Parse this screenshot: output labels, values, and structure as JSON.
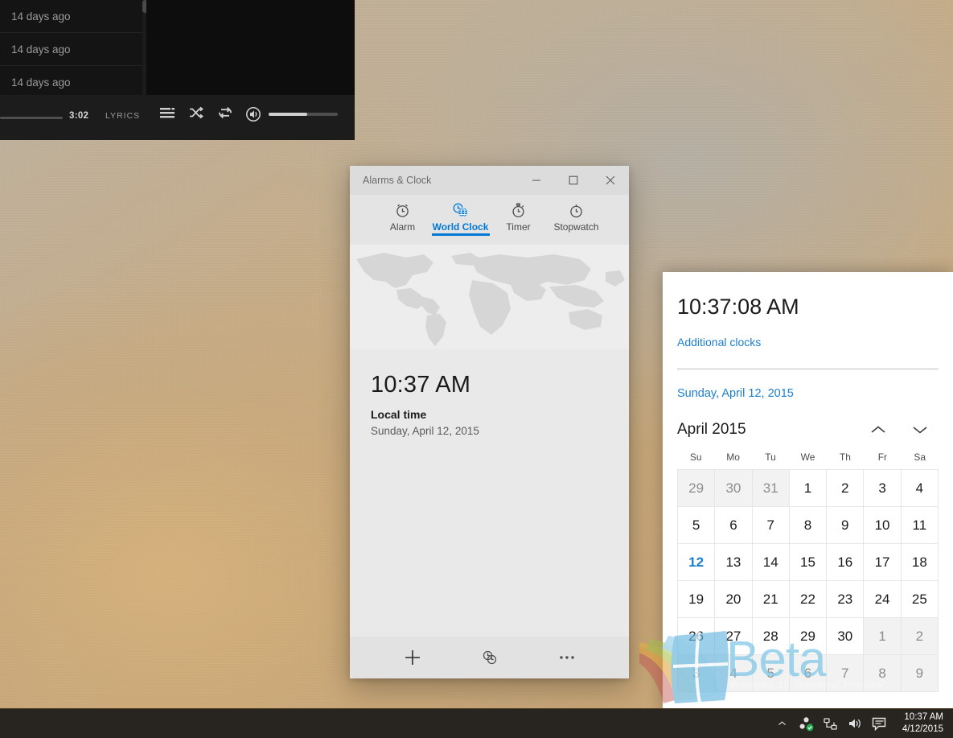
{
  "media_player": {
    "rows": [
      {
        "time_ago": "14 days ago"
      },
      {
        "time_ago": "14 days ago"
      },
      {
        "time_ago": "14 days ago"
      }
    ],
    "track_time": "3:02",
    "lyrics_label": "LYRICS",
    "icons": [
      "queue-icon",
      "shuffle-icon",
      "repeat-icon",
      "volume-icon"
    ]
  },
  "clock_app": {
    "title": "Alarms & Clock",
    "window_buttons": {
      "minimize": "minimize-button",
      "maximize": "maximize-button",
      "close": "close-button"
    },
    "tabs": [
      {
        "label": "Alarm",
        "icon": "alarm-clock-icon",
        "active": false
      },
      {
        "label": "World Clock",
        "icon": "world-clock-icon",
        "active": true
      },
      {
        "label": "Timer",
        "icon": "timer-icon",
        "active": false
      },
      {
        "label": "Stopwatch",
        "icon": "stopwatch-icon",
        "active": false
      }
    ],
    "local": {
      "time": "10:37 AM",
      "label": "Local time",
      "date": "Sunday, April 12, 2015"
    },
    "bottom_bar": [
      {
        "name": "add-clock-button",
        "glyph": "+"
      },
      {
        "name": "compare-clocks-button",
        "glyph": "compare-icon"
      },
      {
        "name": "more-options-button",
        "glyph": "..."
      }
    ]
  },
  "calendar_flyout": {
    "clock": "10:37:08 AM",
    "additional_clocks_link": "Additional clocks",
    "current_date": "Sunday, April 12, 2015",
    "month_label": "April 2015",
    "prev_label": "up-chevron-icon",
    "next_label": "down-chevron-icon",
    "day_headers": [
      "Su",
      "Mo",
      "Tu",
      "We",
      "Th",
      "Fr",
      "Sa"
    ],
    "weeks": [
      [
        {
          "d": "29",
          "other": true
        },
        {
          "d": "30",
          "other": true
        },
        {
          "d": "31",
          "other": true
        },
        {
          "d": "1"
        },
        {
          "d": "2"
        },
        {
          "d": "3"
        },
        {
          "d": "4"
        }
      ],
      [
        {
          "d": "5"
        },
        {
          "d": "6"
        },
        {
          "d": "7"
        },
        {
          "d": "8"
        },
        {
          "d": "9"
        },
        {
          "d": "10"
        },
        {
          "d": "11"
        }
      ],
      [
        {
          "d": "12",
          "today": true
        },
        {
          "d": "13"
        },
        {
          "d": "14"
        },
        {
          "d": "15"
        },
        {
          "d": "16"
        },
        {
          "d": "17"
        },
        {
          "d": "18"
        }
      ],
      [
        {
          "d": "19"
        },
        {
          "d": "20"
        },
        {
          "d": "21"
        },
        {
          "d": "22"
        },
        {
          "d": "23"
        },
        {
          "d": "24"
        },
        {
          "d": "25"
        }
      ],
      [
        {
          "d": "26"
        },
        {
          "d": "27"
        },
        {
          "d": "28"
        },
        {
          "d": "29"
        },
        {
          "d": "30"
        },
        {
          "d": "1",
          "other": true
        },
        {
          "d": "2",
          "other": true
        }
      ],
      [
        {
          "d": "3",
          "other": true
        },
        {
          "d": "4",
          "other": true
        },
        {
          "d": "5",
          "other": true
        },
        {
          "d": "6",
          "other": true
        },
        {
          "d": "7",
          "other": true
        },
        {
          "d": "8",
          "other": true
        },
        {
          "d": "9",
          "other": true
        }
      ]
    ]
  },
  "watermark": {
    "text": "Beta",
    "sub": "Windows 10 Technical Preview"
  },
  "taskbar": {
    "tray_icons": [
      {
        "name": "show-hidden-icons",
        "glyph": "chevron-up-icon"
      },
      {
        "name": "sync-status-icon",
        "glyph": "sync-icon"
      },
      {
        "name": "network-icon",
        "glyph": "network-icon"
      },
      {
        "name": "volume-icon",
        "glyph": "speaker-icon"
      },
      {
        "name": "action-center-icon",
        "glyph": "message-icon"
      }
    ],
    "clock_time": "10:37 AM",
    "clock_date": "4/12/2015"
  },
  "colors": {
    "accent": "#0078d7",
    "link": "#1d7fd0",
    "taskbar": "#282420",
    "window_chrome": "#dcdcdc"
  }
}
